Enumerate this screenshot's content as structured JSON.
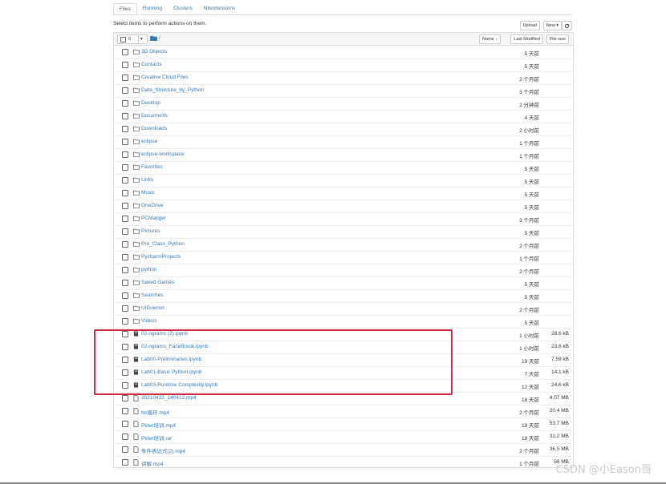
{
  "tabs": [
    {
      "label": "Files",
      "active": true
    },
    {
      "label": "Running",
      "active": false
    },
    {
      "label": "Clusters",
      "active": false
    },
    {
      "label": "Nbextensions",
      "active": false
    }
  ],
  "toolbar": {
    "message": "Select items to perform actions on them.",
    "upload_label": "Upload",
    "new_label": "New ▾",
    "refresh_icon": "refresh-icon"
  },
  "header": {
    "selected_count": "0",
    "dropdown_glyph": "▾",
    "folder_icon": "folder-icon",
    "breadcrumb": "/",
    "sort_name": "Name ↓",
    "sort_modified": "Last Modified",
    "sort_size": "File size"
  },
  "items": [
    {
      "type": "folder",
      "name": "3D Objects",
      "modified": "5 天前",
      "size": ""
    },
    {
      "type": "folder",
      "name": "Contacts",
      "modified": "5 天前",
      "size": ""
    },
    {
      "type": "folder",
      "name": "Creative Cloud Files",
      "modified": "2 个月前",
      "size": ""
    },
    {
      "type": "folder",
      "name": "Data_Structure_by_Python",
      "modified": "3 个月前",
      "size": ""
    },
    {
      "type": "folder",
      "name": "Desktop",
      "modified": "2 分钟前",
      "size": ""
    },
    {
      "type": "folder",
      "name": "Documents",
      "modified": "4 天前",
      "size": ""
    },
    {
      "type": "folder",
      "name": "Downloads",
      "modified": "2 小时前",
      "size": ""
    },
    {
      "type": "folder",
      "name": "eclipse",
      "modified": "1 个月前",
      "size": ""
    },
    {
      "type": "folder",
      "name": "eclipse-workspace",
      "modified": "1 个月前",
      "size": ""
    },
    {
      "type": "folder",
      "name": "Favorites",
      "modified": "5 天前",
      "size": ""
    },
    {
      "type": "folder",
      "name": "Links",
      "modified": "5 天前",
      "size": ""
    },
    {
      "type": "folder",
      "name": "Music",
      "modified": "5 天前",
      "size": ""
    },
    {
      "type": "folder",
      "name": "OneDrive",
      "modified": "5 天前",
      "size": ""
    },
    {
      "type": "folder",
      "name": "PCManger",
      "modified": "3 个月前",
      "size": ""
    },
    {
      "type": "folder",
      "name": "Pictures",
      "modified": "5 天前",
      "size": ""
    },
    {
      "type": "folder",
      "name": "Pre_Class_Python",
      "modified": "2 个月前",
      "size": ""
    },
    {
      "type": "folder",
      "name": "PycharmProjects",
      "modified": "1 个月前",
      "size": ""
    },
    {
      "type": "folder",
      "name": "python",
      "modified": "2 个月前",
      "size": ""
    },
    {
      "type": "folder",
      "name": "Saved Games",
      "modified": "5 天前",
      "size": ""
    },
    {
      "type": "folder",
      "name": "Searches",
      "modified": "5 天前",
      "size": ""
    },
    {
      "type": "folder",
      "name": "UIDowner",
      "modified": "2 个月前",
      "size": ""
    },
    {
      "type": "folder",
      "name": "Videos",
      "modified": "5 天前",
      "size": ""
    },
    {
      "type": "notebook",
      "name": "02-ngrams (2).ipynb",
      "modified": "1 小时前",
      "size": "28.6 kB"
    },
    {
      "type": "notebook",
      "name": "02-ngrams_FaceBrook.ipynb",
      "modified": "1 小时前",
      "size": "23.8 kB"
    },
    {
      "type": "notebook",
      "name": "Lab00-Preliminaries.ipynb",
      "modified": "19 天前",
      "size": "7.59 kB"
    },
    {
      "type": "notebook",
      "name": "Lab01-Basic Python.ipynb",
      "modified": "7 天前",
      "size": "14.1 kB"
    },
    {
      "type": "notebook",
      "name": "Lab03-Runtime Complexity.ipynb",
      "modified": "12 天前",
      "size": "24.6 kB"
    },
    {
      "type": "file",
      "name": "20210422_140412.mp4",
      "modified": "18 天前",
      "size": "4.07 MB"
    },
    {
      "type": "file",
      "name": "for循环.mp4",
      "modified": "2 个月前",
      "size": "20.4 MB"
    },
    {
      "type": "file",
      "name": "Peter培训.mp4",
      "modified": "18 天前",
      "size": "53.7 MB"
    },
    {
      "type": "file",
      "name": "Peter培训.rar",
      "modified": "18 天前",
      "size": "31.2 MB"
    },
    {
      "type": "file",
      "name": "条件表达式(2).mp4",
      "modified": "2 个月前",
      "size": "36.5 MB"
    },
    {
      "type": "file",
      "name": "讲解.mp4",
      "modified": "1 个月前",
      "size": "56 MB"
    }
  ],
  "watermark": "CSDN @小Eason哥",
  "colors": {
    "link": "#337ab7",
    "highlight_box": "#d12c3e",
    "folder_icon": "#337ab7"
  }
}
